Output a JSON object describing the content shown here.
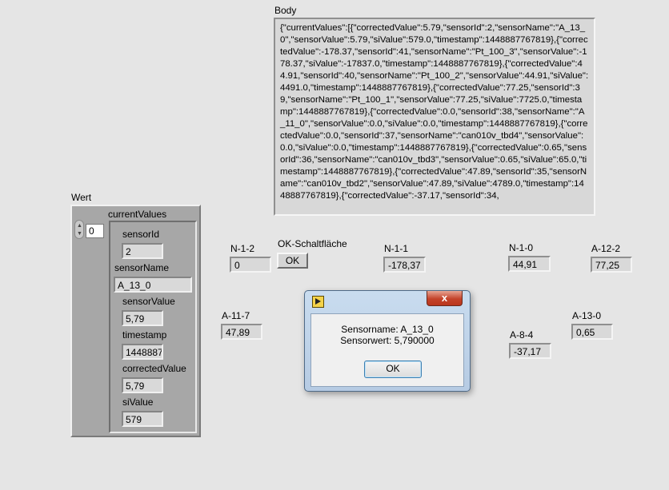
{
  "body": {
    "label": "Body",
    "text": "{\"currentValues\":[{\"correctedValue\":5.79,\"sensorId\":2,\"sensorName\":\"A_13_0\",\"sensorValue\":5.79,\"siValue\":579.0,\"timestamp\":1448887767819},{\"correctedValue\":-178.37,\"sensorId\":41,\"sensorName\":\"Pt_100_3\",\"sensorValue\":-178.37,\"siValue\":-17837.0,\"timestamp\":1448887767819},{\"correctedValue\":44.91,\"sensorId\":40,\"sensorName\":\"Pt_100_2\",\"sensorValue\":44.91,\"siValue\":4491.0,\"timestamp\":1448887767819},{\"correctedValue\":77.25,\"sensorId\":39,\"sensorName\":\"Pt_100_1\",\"sensorValue\":77.25,\"siValue\":7725.0,\"timestamp\":1448887767819},{\"correctedValue\":0.0,\"sensorId\":38,\"sensorName\":\"A_11_0\",\"sensorValue\":0.0,\"siValue\":0.0,\"timestamp\":1448887767819},{\"correctedValue\":0.0,\"sensorId\":37,\"sensorName\":\"can010v_tbd4\",\"sensorValue\":0.0,\"siValue\":0.0,\"timestamp\":1448887767819},{\"correctedValue\":0.65,\"sensorId\":36,\"sensorName\":\"can010v_tbd3\",\"sensorValue\":0.65,\"siValue\":65.0,\"timestamp\":1448887767819},{\"correctedValue\":47.89,\"sensorId\":35,\"sensorName\":\"can010v_tbd2\",\"sensorValue\":47.89,\"siValue\":4789.0,\"timestamp\":1448887767819},{\"correctedValue\":-37.17,\"sensorId\":34,"
  },
  "wert": {
    "label": "Wert",
    "index": "0",
    "cluster_label": "currentValues",
    "fields": {
      "sensorId": {
        "label": "sensorId",
        "value": "2"
      },
      "sensorName": {
        "label": "sensorName",
        "value": "A_13_0"
      },
      "sensorValue": {
        "label": "sensorValue",
        "value": "5,79"
      },
      "timestamp": {
        "label": "timestamp",
        "value": "1448887"
      },
      "correctedValue": {
        "label": "correctedValue",
        "value": "5,79"
      },
      "siValue": {
        "label": "siValue",
        "value": "579"
      }
    }
  },
  "ok_button": {
    "label": "OK-Schaltfläche",
    "text": "OK"
  },
  "indicators": {
    "n12": {
      "label": "N-1-2",
      "value": "0"
    },
    "n11": {
      "label": "N-1-1",
      "value": "-178,37"
    },
    "n10": {
      "label": "N-1-0",
      "value": "44,91"
    },
    "a122": {
      "label": "A-12-2",
      "value": "77,25"
    },
    "a117": {
      "label": "A-11-7",
      "value": "47,89"
    },
    "a130": {
      "label": "A-13-0",
      "value": "0,65"
    },
    "a84": {
      "label": "A-8-4",
      "value": "-37,17"
    }
  },
  "dialog": {
    "line1": "Sensorname: A_13_0",
    "line2": "Sensorwert: 5,790000",
    "ok": "OK",
    "close": "x"
  }
}
